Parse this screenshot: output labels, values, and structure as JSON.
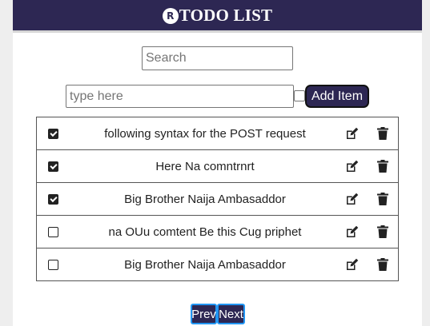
{
  "header": {
    "logo": "R",
    "title": "TODO LIST"
  },
  "search": {
    "placeholder": "Search",
    "value": ""
  },
  "new_item": {
    "placeholder": "type here",
    "value": "",
    "add_label": "Add Item"
  },
  "items": [
    {
      "text": "following syntax for the POST request",
      "done": true
    },
    {
      "text": "Here Na comntrnrt",
      "done": true
    },
    {
      "text": "Big Brother Naija Ambasaddor",
      "done": true
    },
    {
      "text": "na OUu comtent Be this Cug priphet",
      "done": false
    },
    {
      "text": "Big Brother Naija Ambasaddor",
      "done": false
    }
  ],
  "pager": {
    "prev_label": "Prev",
    "next_label": "Next"
  },
  "icons": {
    "edit": "edit-icon",
    "delete": "trash-icon"
  },
  "colors": {
    "brand": "#2d2753",
    "accent": "#2196f3"
  }
}
